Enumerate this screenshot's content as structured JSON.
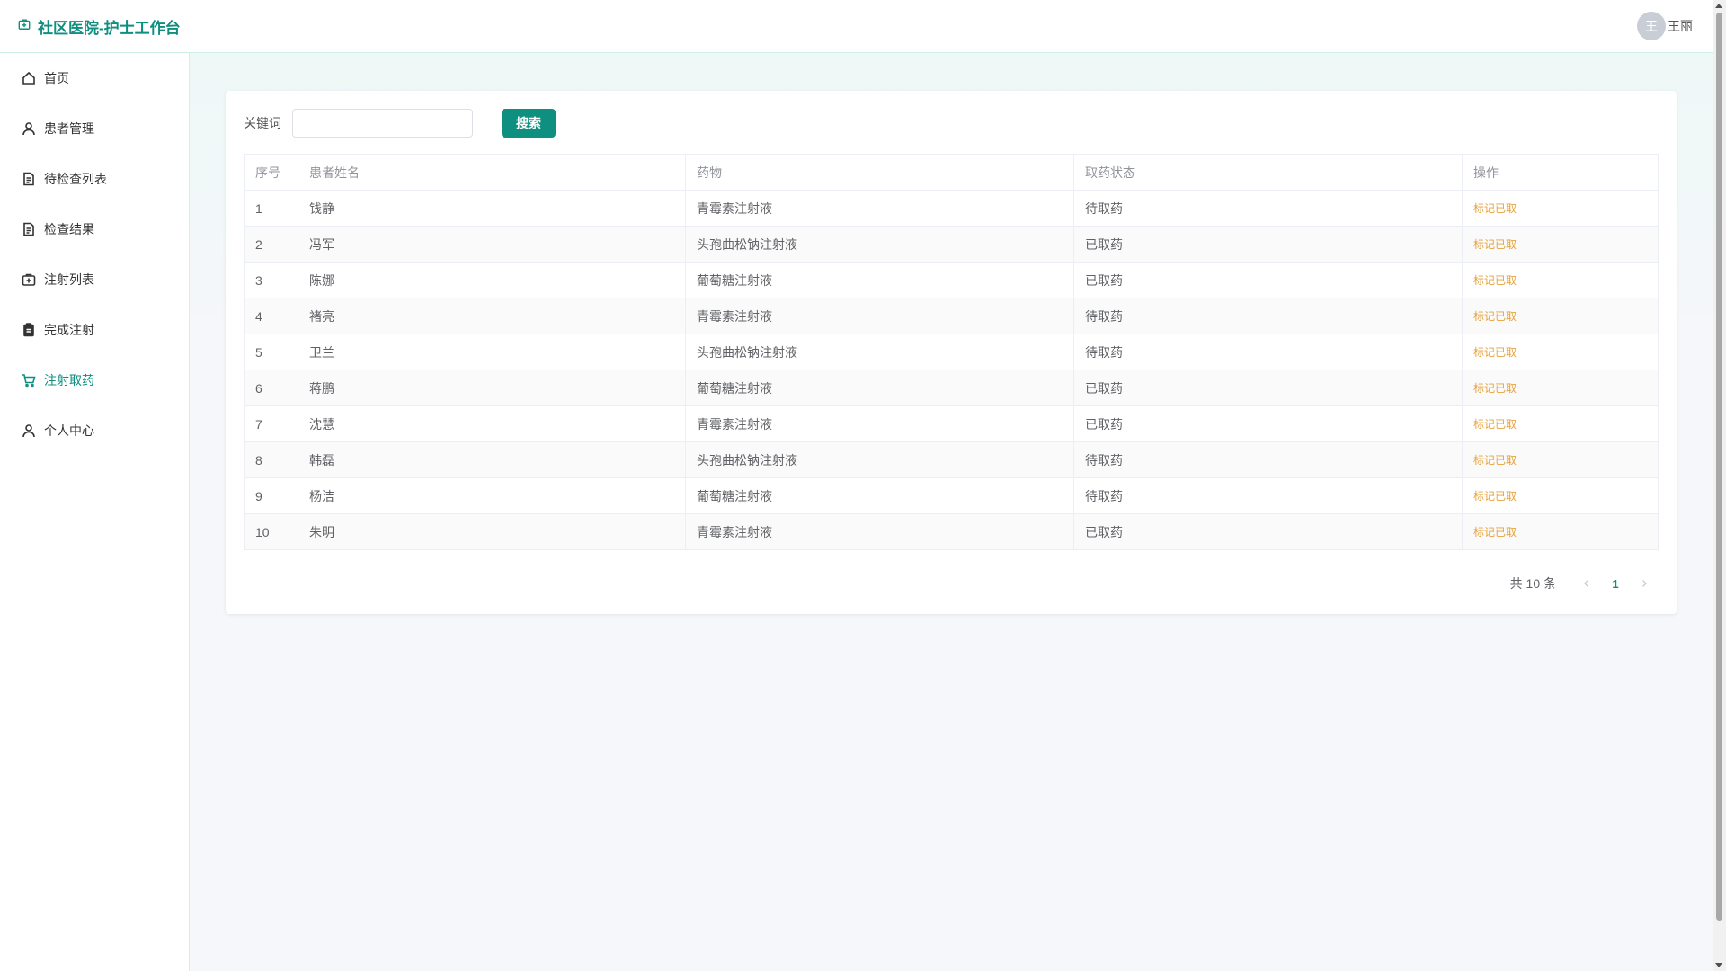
{
  "header": {
    "title": "社区医院-护士工作台",
    "brand_icon": "medical-kit-icon",
    "user_avatar": "王",
    "user_name": "王丽"
  },
  "sidebar": {
    "items": [
      {
        "label": "首页",
        "icon": "home-icon"
      },
      {
        "label": "患者管理",
        "icon": "user-icon"
      },
      {
        "label": "待检查列表",
        "icon": "document-icon"
      },
      {
        "label": "检查结果",
        "icon": "document-icon"
      },
      {
        "label": "注射列表",
        "icon": "medical-kit-icon"
      },
      {
        "label": "完成注射",
        "icon": "clipboard-icon"
      },
      {
        "label": "注射取药",
        "icon": "cart-icon",
        "active": true
      },
      {
        "label": "个人中心",
        "icon": "user-icon"
      }
    ]
  },
  "search": {
    "label": "关键词",
    "value": "",
    "placeholder": "",
    "button": "搜索"
  },
  "table": {
    "headers": [
      "序号",
      "患者姓名",
      "药物",
      "取药状态",
      "操作"
    ],
    "rows": [
      [
        "1",
        "钱静",
        "青霉素注射液",
        "待取药",
        "标记已取"
      ],
      [
        "2",
        "冯军",
        "头孢曲松钠注射液",
        "已取药",
        "标记已取"
      ],
      [
        "3",
        "陈娜",
        "葡萄糖注射液",
        "已取药",
        "标记已取"
      ],
      [
        "4",
        "褚亮",
        "青霉素注射液",
        "待取药",
        "标记已取"
      ],
      [
        "5",
        "卫兰",
        "头孢曲松钠注射液",
        "待取药",
        "标记已取"
      ],
      [
        "6",
        "蒋鹏",
        "葡萄糖注射液",
        "已取药",
        "标记已取"
      ],
      [
        "7",
        "沈慧",
        "青霉素注射液",
        "已取药",
        "标记已取"
      ],
      [
        "8",
        "韩磊",
        "头孢曲松钠注射液",
        "待取药",
        "标记已取"
      ],
      [
        "9",
        "杨洁",
        "葡萄糖注射液",
        "待取药",
        "标记已取"
      ],
      [
        "10",
        "朱明",
        "青霉素注射液",
        "已取药",
        "标记已取"
      ]
    ]
  },
  "pagination": {
    "total_text": "共 10 条",
    "current_page": "1"
  },
  "colors": {
    "accent": "#0f8f80",
    "link_warning": "#e6a23c"
  }
}
